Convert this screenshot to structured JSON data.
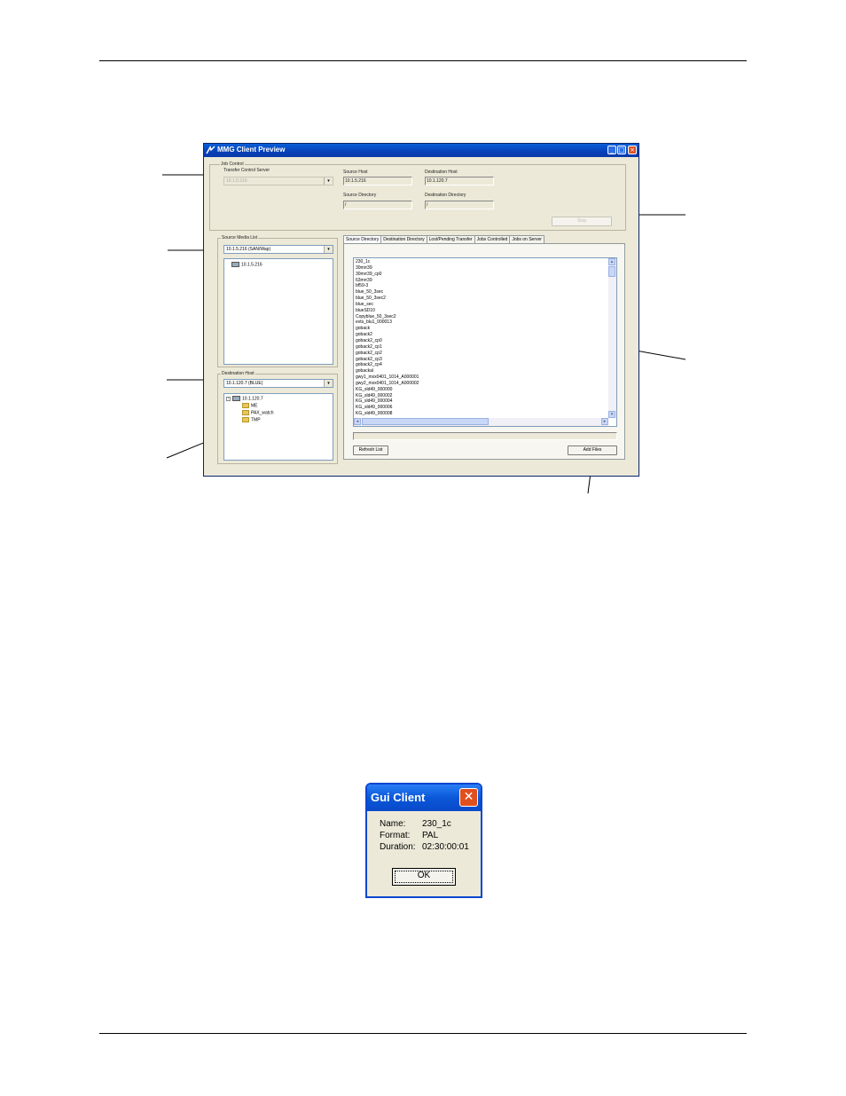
{
  "main_window": {
    "title": "MMG Client Preview",
    "job_control": {
      "group_label": "Job Control",
      "transfer_control_server_label": "Transfer Control Server",
      "transfer_control_server_value": "10.1.5.216",
      "source_host_label": "Source Host",
      "source_host_value": "10.1.5.216",
      "destination_host_label": "Destination Host",
      "destination_host_value": "10.1.120.7",
      "source_directory_label": "Source Directory",
      "source_directory_value": "/",
      "destination_directory_label": "Destination Directory",
      "destination_directory_value": "/",
      "stop_button": "Stop"
    },
    "source_media_list": {
      "group_label": "Source Media List",
      "selected": "10.1.5.216 (SAN/Wap)",
      "tree_root": "10.1.5.216"
    },
    "destination_host": {
      "group_label": "Destination Host",
      "selected": "10.1.120.7 (BLUE)",
      "tree_root": "10.1.120.7",
      "folders": [
        "ME",
        "PAX_watch",
        "TMP"
      ]
    },
    "tabs": [
      "Source Directory",
      "Destination Directory",
      "Lost/Pending Transfer",
      "Jobs Controlled",
      "Jobs on Server"
    ],
    "active_tab": "Source Directory",
    "files": [
      "230_1c",
      "30mrr39",
      "30mrr39_cp0",
      "63mrr39",
      "bf59-3",
      "blue_50_3sec",
      "blue_50_3sec2",
      "blue_sec",
      "blueSD10",
      "Copyblue_50_3sec2",
      "evts_blu1_000013",
      "goback",
      "goback2",
      "goback2_cp0",
      "goback2_cp1",
      "goback2_cp2",
      "goback2_cp3",
      "goback2_cp4",
      "gobackal",
      "gwy1_mxx0401_1014_A000001",
      "gwy2_mxx0401_1014_A000002",
      "KG_sld49_000000",
      "KG_sld49_000002",
      "KG_sld49_000004",
      "KG_sld49_000006",
      "KG_sld49_000008"
    ],
    "refresh_button": "Refresh List",
    "add_files_button": "Add Files"
  },
  "dialog": {
    "title": "Gui Client",
    "name_label": "Name:",
    "name_value": "230_1c",
    "format_label": "Format:",
    "format_value": "PAL",
    "duration_label": "Duration:",
    "duration_value": "02:30:00:01",
    "ok_button": "OK"
  },
  "colors": {
    "titlebar": "#0a46d0",
    "window_face": "#ece9d8",
    "close_button": "#e0501e"
  },
  "icons": [
    "app-icon",
    "minimize-icon",
    "maximize-icon",
    "close-icon",
    "computer-icon",
    "folder-icon",
    "dropdown-arrow-icon",
    "scroll-up-icon",
    "scroll-down-icon",
    "scroll-left-icon",
    "scroll-right-icon"
  ]
}
